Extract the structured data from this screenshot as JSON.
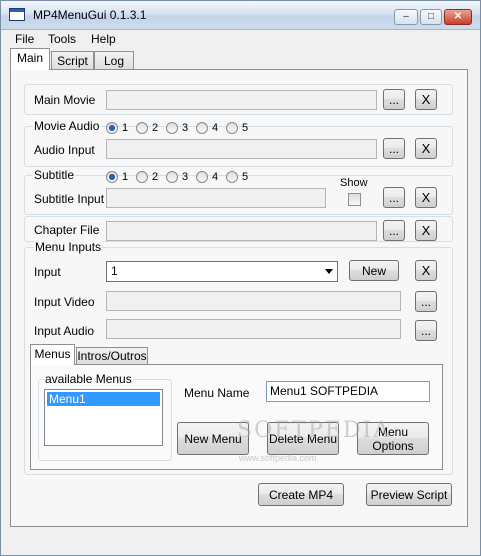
{
  "window": {
    "title": "MP4MenuGui 0.1.3.1",
    "controls": {
      "minimize": "–",
      "maximize": "□",
      "close": "✕"
    }
  },
  "menubar": {
    "items": [
      "File",
      "Tools",
      "Help"
    ]
  },
  "tabs": [
    "Main",
    "Script",
    "Log"
  ],
  "main": {
    "main_movie": {
      "label": "Main Movie",
      "browse": "...",
      "clear": "X"
    },
    "movie_audio": {
      "legend": "Movie Audio",
      "options": [
        "1",
        "2",
        "3",
        "4",
        "5"
      ],
      "selected": "1"
    },
    "audio_input": {
      "label": "Audio Input",
      "browse": "...",
      "clear": "X"
    },
    "subtitle": {
      "legend": "Subtitle",
      "options": [
        "1",
        "2",
        "3",
        "4",
        "5"
      ],
      "selected": "1",
      "show_label": "Show",
      "show_checked": false
    },
    "subtitle_input": {
      "label": "Subtitle Input",
      "browse": "...",
      "clear": "X"
    },
    "chapter_file": {
      "label": "Chapter File",
      "browse": "...",
      "clear": "X"
    },
    "menu_inputs": {
      "legend": "Menu Inputs",
      "input_label": "Input",
      "input_value": "1",
      "new_button": "New",
      "clear": "X",
      "input_video_label": "Input Video",
      "input_audio_label": "Input Audio",
      "browse": "..."
    },
    "inner_tabs": [
      "Menus",
      "Intros/Outros"
    ],
    "menus": {
      "available_legend": "available Menus",
      "items": [
        "Menu1"
      ],
      "menu_name_label": "Menu Name",
      "menu_name_value": "Menu1 SOFTPEDIA",
      "new_menu": "New Menu",
      "delete_menu": "Delete Menu",
      "menu_options": "Menu Options"
    },
    "create_mp4": "Create MP4",
    "preview_script": "Preview Script"
  },
  "watermark": {
    "text": "SOFTPEDIA",
    "sub": "www.softpedia.com"
  },
  "colors": {
    "selection": "#3399ff",
    "radio_selected": "#1f5bb5"
  }
}
